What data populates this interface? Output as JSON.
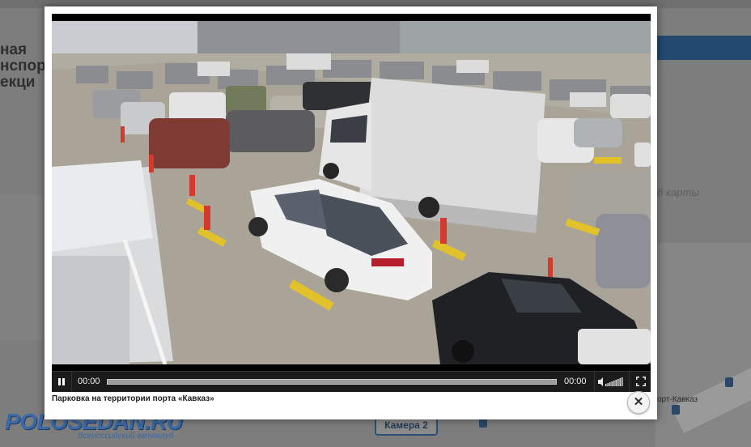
{
  "background_page": {
    "heading_lines": "ная\nнспор\nекци",
    "right_text": "б карты",
    "map_label": "орт-Кавказ",
    "camera_tag": "Камера 2",
    "logo": {
      "main": "POLOSEDAN.RU",
      "sub": "Всероссийский автоклуб"
    }
  },
  "player": {
    "state": "playing",
    "current_time": "00:00",
    "duration": "00:00",
    "progress_fraction": 0,
    "volume_fraction": 1,
    "pause_icon": "pause-icon",
    "volume_icon": "volume-icon",
    "fullscreen_icon": "fullscreen-icon",
    "close_icon": "close-icon"
  },
  "caption": "Парковка на территории порта «Кавказ»",
  "colors": {
    "overlay": "#7d7d7d",
    "controls_bg": "#1b1b1b",
    "logo_blue": "#3a6aa8"
  }
}
